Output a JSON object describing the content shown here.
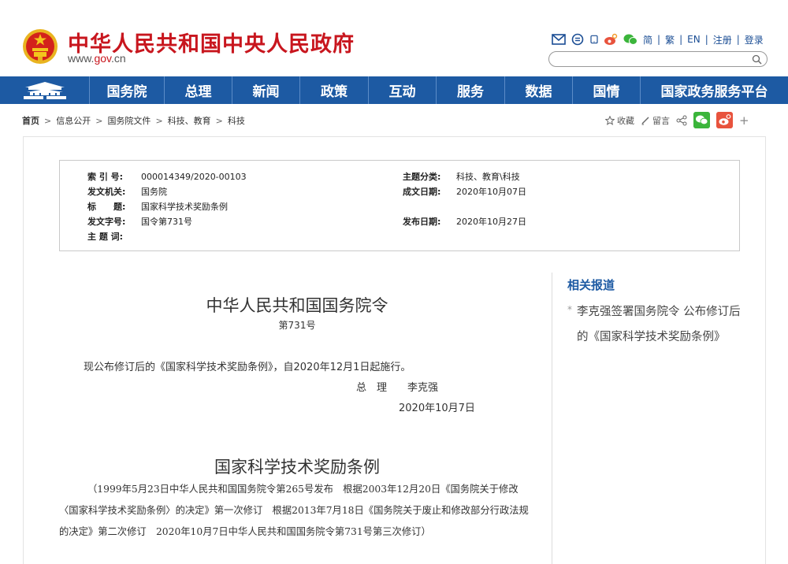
{
  "header": {
    "site_title": "中华人民共和国中央人民政府",
    "url_prefix": "www.",
    "url_brand": "gov",
    "url_suffix": ".cn",
    "links": [
      "简",
      "繁",
      "EN",
      "注册",
      "登录"
    ],
    "icons": [
      "mail-icon",
      "comment-icon",
      "mobile-icon",
      "weibo-icon",
      "wechat-icon"
    ],
    "search_placeholder": ""
  },
  "nav": {
    "items": [
      "国务院",
      "总理",
      "新闻",
      "政策",
      "互动",
      "服务",
      "数据",
      "国情",
      "国家政务服务平台"
    ]
  },
  "breadcrumb": {
    "items": [
      "首页",
      "信息公开",
      "国务院文件",
      "科技、教育",
      "科技"
    ],
    "separator": ">"
  },
  "share": {
    "favorite": "收藏",
    "comment": "留言",
    "plus": "+"
  },
  "info": {
    "index_label": "索 引 号:",
    "index_value": "000014349/2020-00103",
    "topic_label": "主题分类:",
    "topic_value": "科技、教育\\科技",
    "issuer_label": "发文机关:",
    "issuer_value": "国务院",
    "date_made_label": "成文日期:",
    "date_made_value": "2020年10月07日",
    "title_label": "标　　题:",
    "title_value": "国家科学技术奖励条例",
    "docno_label": "发文字号:",
    "docno_value": "国令第731号",
    "pub_date_label": "发布日期:",
    "pub_date_value": "2020年10月27日",
    "keywords_label": "主 题 词:",
    "keywords_value": ""
  },
  "article": {
    "order_title": "中华人民共和国国务院令",
    "order_number": "第731号",
    "body": "现公布修订后的《国家科学技术奖励条例》，自2020年12月1日起施行。",
    "signer": "总　理　　李克强",
    "sign_date": "2020年10月7日",
    "reg_title": "国家科学技术奖励条例",
    "reg_note": "（1999年5月23日中华人民共和国国务院令第265号发布　根据2003年12月20日《国务院关于修改〈国家科学技术奖励条例〉的决定》第一次修订　根据2013年7月18日《国务院关于废止和修改部分行政法规的决定》第二次修订　2020年10月7日中华人民共和国国务院令第731号第三次修订）"
  },
  "sidebar": {
    "title": "相关报道",
    "bullet": "*",
    "items": [
      "李克强签署国务院令 公布修订后的《国家科学技术奖励条例》"
    ]
  },
  "colors": {
    "brand_red": "#c8161e",
    "nav_blue": "#1d5aa3",
    "link_blue": "#1a4d94"
  }
}
